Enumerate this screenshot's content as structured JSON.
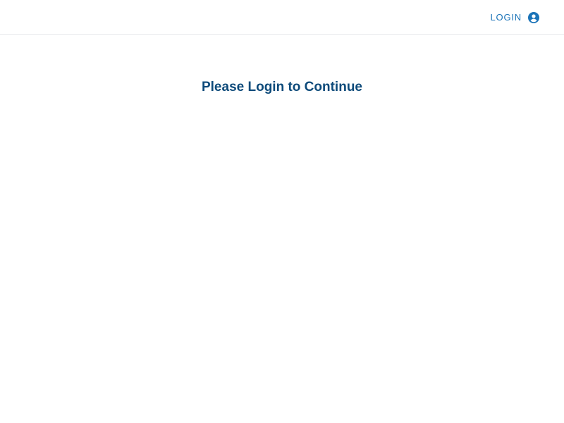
{
  "header": {
    "login_label": "LOGIN",
    "login_icon": "account-circle-icon",
    "accent_color": "#1a73b8"
  },
  "main": {
    "message": "Please Login to Continue",
    "message_color": "#0d4a7a"
  }
}
